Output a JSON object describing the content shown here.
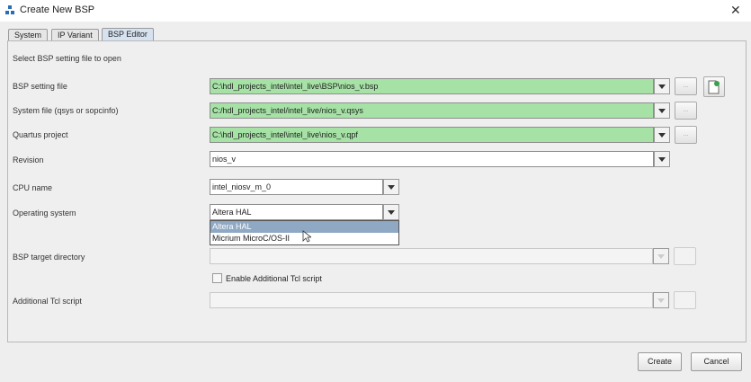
{
  "window": {
    "title": "Create New BSP"
  },
  "tabs": [
    {
      "label": "System"
    },
    {
      "label": "IP Variant"
    },
    {
      "label": "BSP Editor"
    }
  ],
  "panel": {
    "instruction": "Select BSP setting file to open",
    "bsp_setting_file": {
      "label": "BSP setting file",
      "value": "C:\\hdl_projects_intel\\intel_live\\BSP\\nios_v.bsp",
      "browse": "..."
    },
    "system_file": {
      "label": "System file (qsys or sopcinfo)",
      "value": "C:/hdl_projects_intel/intel_live/nios_v.qsys",
      "browse": "..."
    },
    "quartus_project": {
      "label": "Quartus project",
      "value": "C:\\hdl_projects_intel\\intel_live\\nios_v.qpf",
      "browse": "..."
    },
    "revision": {
      "label": "Revision",
      "value": "nios_v"
    },
    "cpu_name": {
      "label": "CPU name",
      "value": "intel_niosv_m_0"
    },
    "operating_system": {
      "label": "Operating system",
      "value": "Altera HAL",
      "options": [
        "Altera HAL",
        "Micrium MicroC/OS-II"
      ]
    },
    "bsp_target_directory": {
      "label": "BSP target directory",
      "value": ""
    },
    "enable_tcl": {
      "label": "Enable Additional Tcl script",
      "checked": false
    },
    "additional_tcl": {
      "label": "Additional Tcl script",
      "value": ""
    }
  },
  "footer": {
    "create": "Create",
    "cancel": "Cancel"
  }
}
